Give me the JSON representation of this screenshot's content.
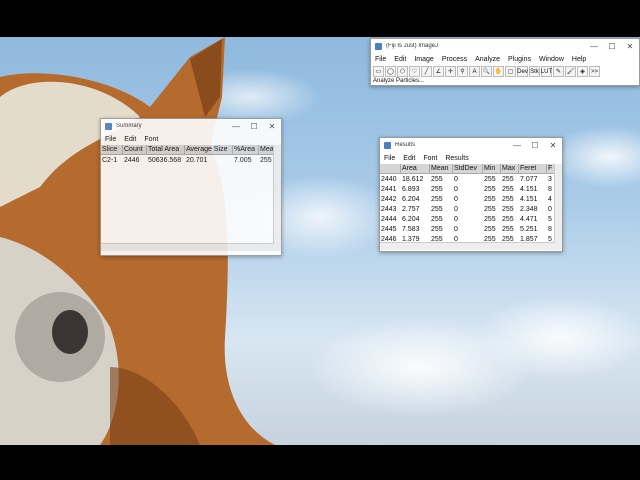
{
  "imagej": {
    "title": "(Fiji Is Just) ImageJ",
    "menu": [
      "File",
      "Edit",
      "Image",
      "Process",
      "Analyze",
      "Plugins",
      "Window",
      "Help"
    ],
    "tools": [
      {
        "icon": "rectangle-tool-icon",
        "glyph": "▭"
      },
      {
        "icon": "oval-tool-icon",
        "glyph": "◯"
      },
      {
        "icon": "polygon-tool-icon",
        "glyph": "⬠"
      },
      {
        "icon": "freehand-tool-icon",
        "glyph": "♡"
      },
      {
        "icon": "line-tool-icon",
        "glyph": "╱"
      },
      {
        "icon": "angle-tool-icon",
        "glyph": "∠"
      },
      {
        "icon": "point-tool-icon",
        "glyph": "✛"
      },
      {
        "icon": "wand-tool-icon",
        "glyph": "⚲"
      },
      {
        "icon": "text-tool-icon",
        "glyph": "A"
      },
      {
        "icon": "magnifier-tool-icon",
        "glyph": "🔍"
      },
      {
        "icon": "hand-tool-icon",
        "glyph": "✋"
      },
      {
        "icon": "color-picker-tool-icon",
        "glyph": "▢"
      },
      {
        "icon": "dev-tool-icon",
        "glyph": "Dev"
      },
      {
        "icon": "stack-tool-icon",
        "glyph": "Stk"
      },
      {
        "icon": "lut-tool-icon",
        "glyph": "LUT"
      },
      {
        "icon": "pencil-tool-icon",
        "glyph": "✎"
      },
      {
        "icon": "brush-tool-icon",
        "glyph": "🖌"
      },
      {
        "icon": "flood-fill-tool-icon",
        "glyph": "◈"
      },
      {
        "icon": "more-tools-icon",
        "glyph": ">>"
      }
    ],
    "status": "Analyze Particles..."
  },
  "summary": {
    "title": "Summary",
    "menu": [
      "File",
      "Edit",
      "Font"
    ],
    "columns": [
      "Slice",
      "Count",
      "Total Area",
      "Average Size",
      "%Area",
      "Mea"
    ],
    "rows": [
      [
        "C2-1",
        "2446",
        "50636.568",
        "20.701",
        "7.005",
        "255"
      ]
    ]
  },
  "results": {
    "title": "Results",
    "menu": [
      "File",
      "Edit",
      "Font",
      "Results"
    ],
    "columns": [
      "",
      "Area",
      "Mean",
      "StdDev",
      "Min",
      "Max",
      "Feret",
      "F"
    ],
    "rows": [
      [
        "2440",
        "18.612",
        "255",
        "0",
        "255",
        "255",
        "7.077",
        "3"
      ],
      [
        "2441",
        "6.893",
        "255",
        "0",
        "255",
        "255",
        "4.151",
        "8"
      ],
      [
        "2442",
        "6.204",
        "255",
        "0",
        "255",
        "255",
        "4.151",
        "4"
      ],
      [
        "2443",
        "2.757",
        "255",
        "0",
        "255",
        "255",
        "2.348",
        "0"
      ],
      [
        "2444",
        "6.204",
        "255",
        "0",
        "255",
        "255",
        "4.471",
        "5"
      ],
      [
        "2445",
        "7.583",
        "255",
        "0",
        "255",
        "255",
        "5.251",
        "8"
      ],
      [
        "2446",
        "1.379",
        "255",
        "0",
        "255",
        "255",
        "1.857",
        "5"
      ]
    ]
  },
  "controls": {
    "minimize": "—",
    "maximize": "☐",
    "close": "✕"
  }
}
